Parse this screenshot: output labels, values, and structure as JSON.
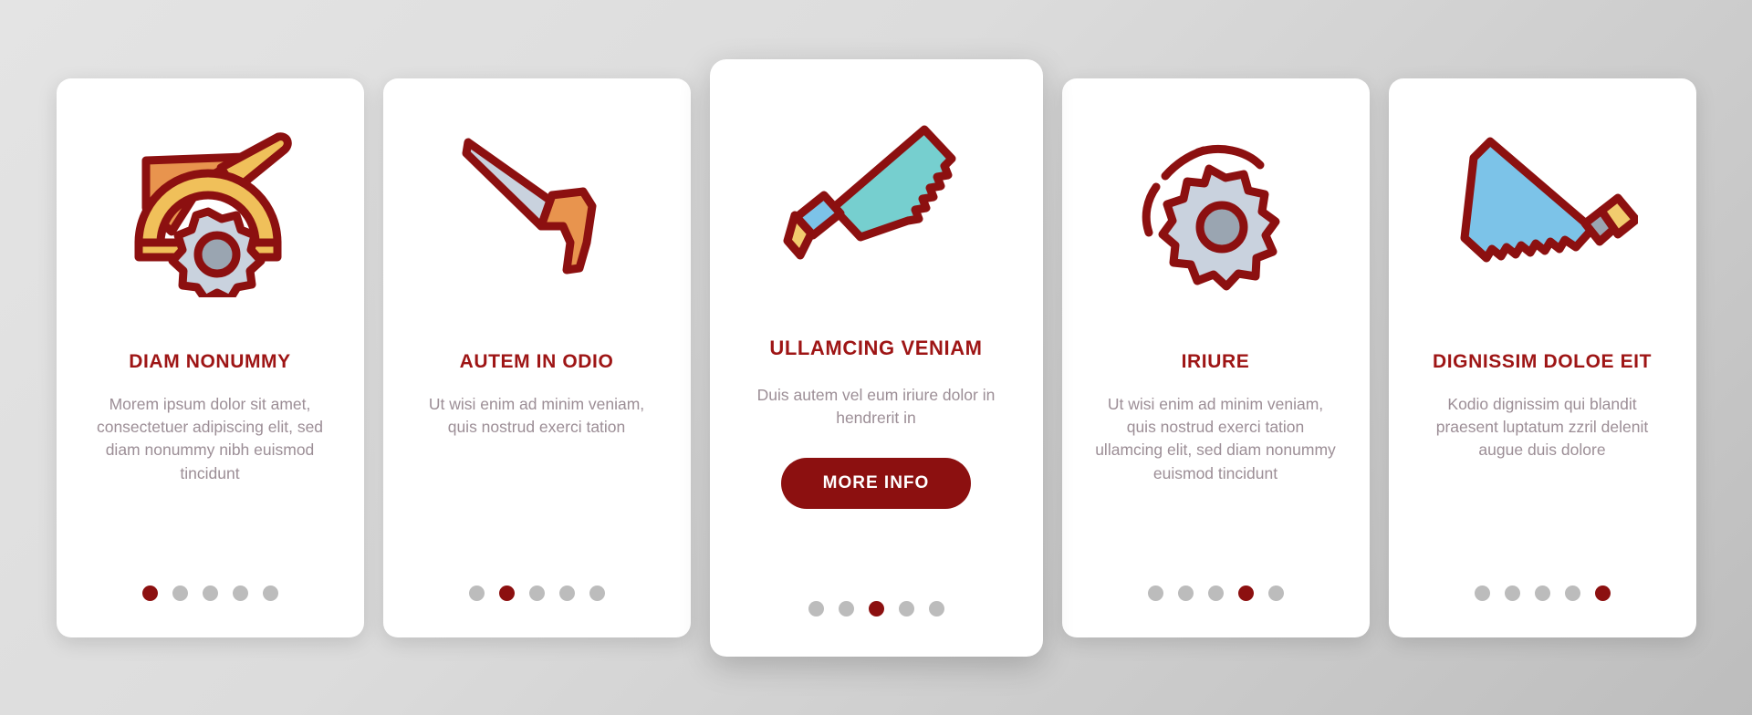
{
  "theme": {
    "accent": "#9e1515",
    "button_bg": "#8c1010",
    "body_text": "#9c8e96",
    "dot_inactive": "#bcbcbc",
    "card_bg": "#ffffff",
    "page_bg": "#dcdcdc"
  },
  "cards": [
    {
      "icon": "circular-saw-machine-icon",
      "title": "DIAM NONUMMY",
      "body": "Morem ipsum dolor sit amet, consectetuer adipiscing elit, sed diam nonummy nibh euismod tincidunt",
      "dots": {
        "count": 5,
        "active": 1
      },
      "featured": false,
      "button": null
    },
    {
      "icon": "hand-saw-icon",
      "title": "AUTEM IN ODIO",
      "body": "Ut wisi enim ad minim veniam, quis nostrud exerci tation",
      "dots": {
        "count": 5,
        "active": 2
      },
      "featured": false,
      "button": null
    },
    {
      "icon": "teal-handsaw-icon",
      "title": "ULLAMCING VENIAM",
      "body": "Duis autem vel eum iriure dolor in hendrerit in",
      "dots": {
        "count": 5,
        "active": 3
      },
      "featured": true,
      "button": "MORE INFO"
    },
    {
      "icon": "spinning-saw-blade-icon",
      "title": "IRIURE",
      "body": "Ut wisi enim ad minim veniam, quis nostrud exerci tation ullamcing elit, sed diam nonummy euismod tincidunt",
      "dots": {
        "count": 5,
        "active": 4
      },
      "featured": false,
      "button": null
    },
    {
      "icon": "blue-saw-icon",
      "title": "DIGNISSIM DOLOE EIT",
      "body": "Kodio dignissim qui blandit praesent luptatum zzril delenit augue duis dolore",
      "dots": {
        "count": 5,
        "active": 5
      },
      "featured": false,
      "button": null
    }
  ]
}
